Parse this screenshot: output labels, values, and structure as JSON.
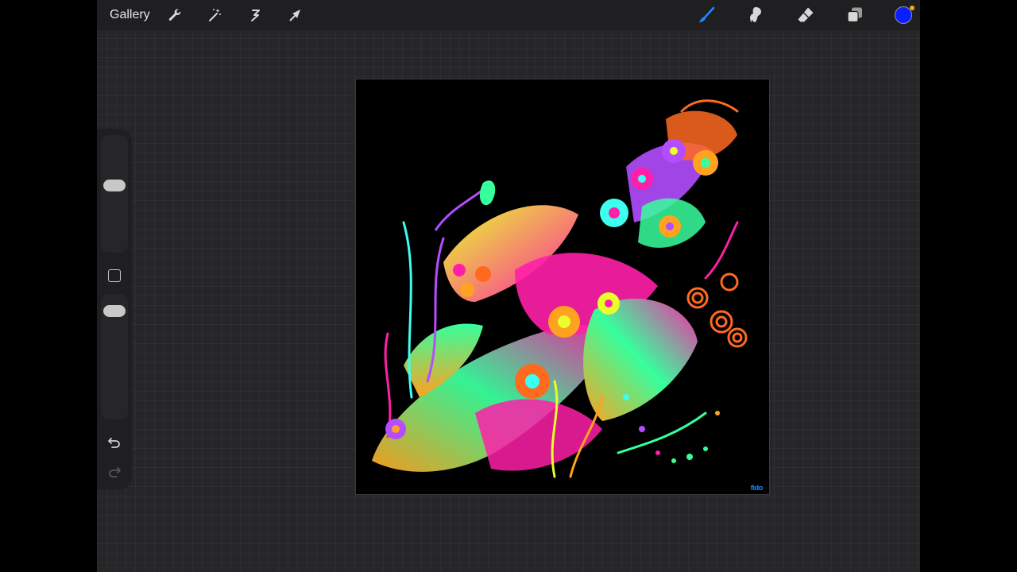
{
  "toolbar": {
    "gallery_label": "Gallery",
    "left_icons": [
      "wrench-icon",
      "magic-wand-icon",
      "selection-icon",
      "transform-arrow-icon"
    ],
    "right_icons": [
      "brush-icon",
      "smudge-icon",
      "eraser-icon",
      "layers-icon"
    ],
    "current_color": "#0a1eff",
    "accent_color": "#1a8cff",
    "notification_color": "#f5a623"
  },
  "sidebar": {
    "icons": [
      "brush-size-slider",
      "modify-square-icon",
      "opacity-slider",
      "undo-icon",
      "redo-icon"
    ]
  },
  "canvas": {
    "background_color": "#000000",
    "artwork_signature": "fido",
    "artwork_colors": [
      "#ff1fa8",
      "#37ff9c",
      "#ffa21f",
      "#b44dff",
      "#e8ff2b",
      "#ff6a1f",
      "#3dfff0"
    ]
  }
}
